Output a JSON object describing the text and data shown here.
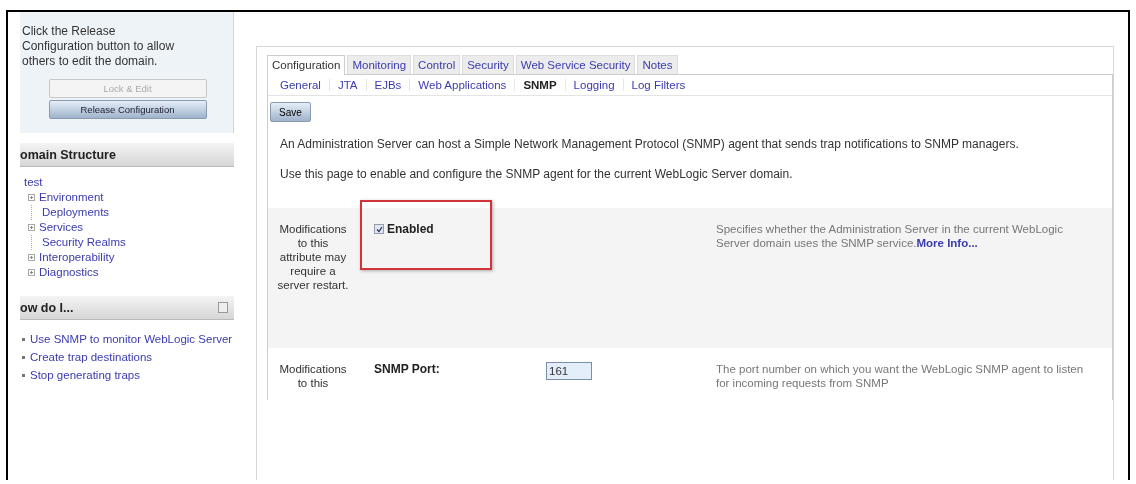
{
  "change_center": {
    "message": "Click the Release Configuration button to allow others to edit the domain.",
    "buttons": [
      {
        "label": "Lock & Edit",
        "disabled": true
      },
      {
        "label": "Release Configuration",
        "disabled": false
      }
    ]
  },
  "domain_structure": {
    "title": "omain Structure",
    "tree": [
      {
        "label": "test",
        "children": [
          {
            "label": "Environment",
            "expandable": true
          },
          {
            "label": "Deployments",
            "expandable": false
          },
          {
            "label": "Services",
            "expandable": true
          },
          {
            "label": "Security Realms",
            "expandable": false
          },
          {
            "label": "Interoperability",
            "expandable": true
          },
          {
            "label": "Diagnostics",
            "expandable": true
          }
        ]
      }
    ]
  },
  "how_do_i": {
    "title": "ow do I...",
    "links": [
      "Use SNMP to monitor WebLogic Server",
      "Create trap destinations",
      "Stop generating traps"
    ]
  },
  "tabs": [
    {
      "label": "Configuration",
      "selected": true
    },
    {
      "label": "Monitoring",
      "selected": false
    },
    {
      "label": "Control",
      "selected": false
    },
    {
      "label": "Security",
      "selected": false
    },
    {
      "label": "Web Service Security",
      "selected": false
    },
    {
      "label": "Notes",
      "selected": false
    }
  ],
  "subtabs": [
    {
      "label": "General",
      "selected": false
    },
    {
      "label": "JTA",
      "selected": false
    },
    {
      "label": "EJBs",
      "selected": false
    },
    {
      "label": "Web Applications",
      "selected": false
    },
    {
      "label": "SNMP",
      "selected": true
    },
    {
      "label": "Logging",
      "selected": false
    },
    {
      "label": "Log Filters",
      "selected": false
    }
  ],
  "save_button": "Save",
  "intro": [
    "An Administration Server can host a Simple Network Management Protocol (SNMP) agent that sends trap notifications to SNMP managers.",
    "Use this page to enable and configure the SNMP agent for the current WebLogic Server domain."
  ],
  "settings": [
    {
      "kind": "checkbox",
      "note": "Modifications to this attribute may require a server restart.",
      "label": "Enabled",
      "checked": true,
      "highlighted": true,
      "description": "Specifies whether the Administration Server in the current WebLogic Server domain uses the SNMP service.",
      "more_info": "More Info..."
    },
    {
      "kind": "text",
      "note": "Modifications to this",
      "label": "SNMP Port:",
      "value": "161",
      "highlighted": false,
      "description": "The port number on which you want the WebLogic SNMP agent to listen for incoming requests from SNMP"
    }
  ]
}
